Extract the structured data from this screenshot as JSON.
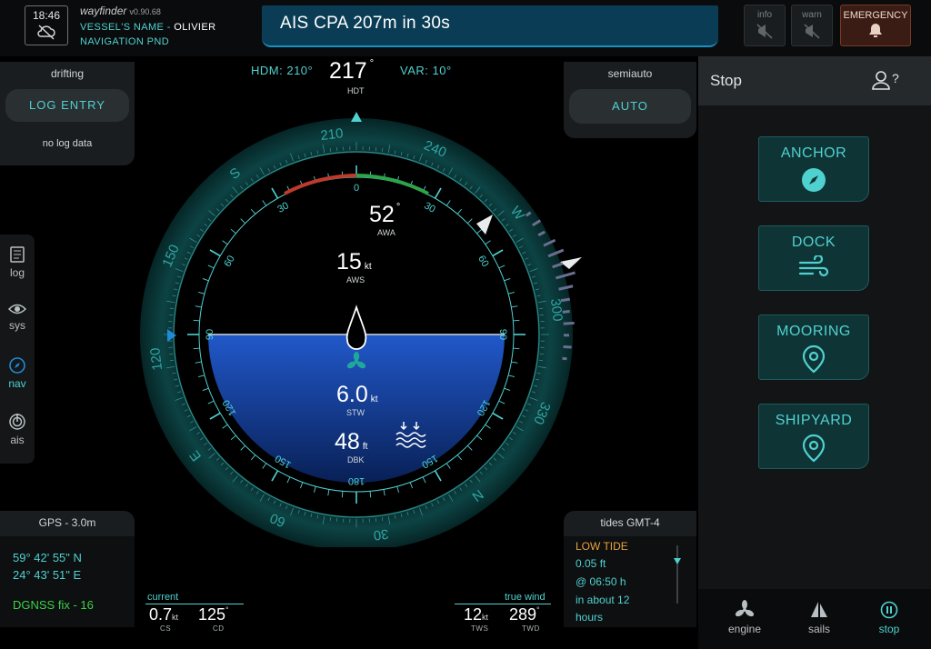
{
  "topbar": {
    "time": "18:46",
    "brand": "wayfinder",
    "version": "v0.90.68",
    "vessel_label": "VESSEL'S NAME",
    "vessel_name": "OLIVIER",
    "nav_mode": "NAVIGATION PND",
    "alert": "AIS CPA 207m in 30s",
    "info_label": "info",
    "warn_label": "warn",
    "emergency_label": "EMERGENCY"
  },
  "heading": {
    "hdm_label": "HDM:",
    "hdm": "210°",
    "hdt": "217",
    "hdt_deg": "°",
    "hdt_label": "HDT",
    "var_label": "VAR:",
    "var": "10°"
  },
  "left_top": {
    "status": "drifting",
    "log_button": "LOG ENTRY",
    "log_text": "no log data"
  },
  "autopilot": {
    "status": "semiauto",
    "button": "AUTO"
  },
  "sidenav": {
    "items": [
      {
        "label": "log",
        "icon": "log-icon"
      },
      {
        "label": "sys",
        "icon": "eye-icon"
      },
      {
        "label": "nav",
        "icon": "compass-icon"
      },
      {
        "label": "ais",
        "icon": "radar-icon"
      }
    ],
    "active": "nav"
  },
  "gauge": {
    "awa": "52",
    "awa_deg": "°",
    "awa_label": "AWA",
    "aws": "15",
    "aws_unit": "kt",
    "aws_label": "AWS",
    "stw": "6.0",
    "stw_unit": "kt",
    "stw_label": "STW",
    "dbk": "48",
    "dbk_unit": "ft",
    "dbk_label": "DBK",
    "outer_labels": [
      "210",
      "240",
      "W",
      "300",
      "330",
      "N",
      "30",
      "60",
      "E",
      "120",
      "150",
      "S"
    ],
    "inner_labels": [
      "0",
      "30",
      "60",
      "90",
      "120",
      "150",
      "180",
      "150",
      "120",
      "90",
      "60",
      "30"
    ]
  },
  "gps": {
    "title": "GPS - 3.0m",
    "lat": "59° 42' 55\" N",
    "lon": "24° 43' 51\" E",
    "fix": "DGNSS fix - 16"
  },
  "current": {
    "label": "current",
    "cs": "0.7",
    "cs_unit": "kt",
    "cs_label": "CS",
    "cd": "125",
    "cd_deg": "°",
    "cd_label": "CD"
  },
  "truewind": {
    "label": "true wind",
    "tws": "12",
    "tws_unit": "kt",
    "tws_label": "TWS",
    "twd": "289",
    "twd_deg": "°",
    "twd_label": "TWD"
  },
  "tides": {
    "title": "tides GMT-4",
    "state": "LOW TIDE",
    "height": "0.05 ft",
    "time": "@ 06:50 h",
    "eta": "in about 12",
    "eta2": "hours"
  },
  "right": {
    "title": "Stop",
    "modes": [
      {
        "label": "ANCHOR",
        "icon": "compass-icon"
      },
      {
        "label": "DOCK",
        "icon": "wind-icon"
      },
      {
        "label": "MOORING",
        "icon": "location-pin-icon"
      },
      {
        "label": "SHIPYARD",
        "icon": "location-pin-icon"
      }
    ],
    "tabs": [
      {
        "label": "engine",
        "icon": "propeller-icon"
      },
      {
        "label": "sails",
        "icon": "sail-icon"
      },
      {
        "label": "stop",
        "icon": "pause-icon"
      }
    ]
  },
  "colors": {
    "accent": "#4fd1d0",
    "alert_bg": "#0a3d55",
    "emergency": "#3a1c14",
    "water": "#1f4fb8",
    "tide": "#e8a23a",
    "gps_fix": "#3cd34a"
  }
}
